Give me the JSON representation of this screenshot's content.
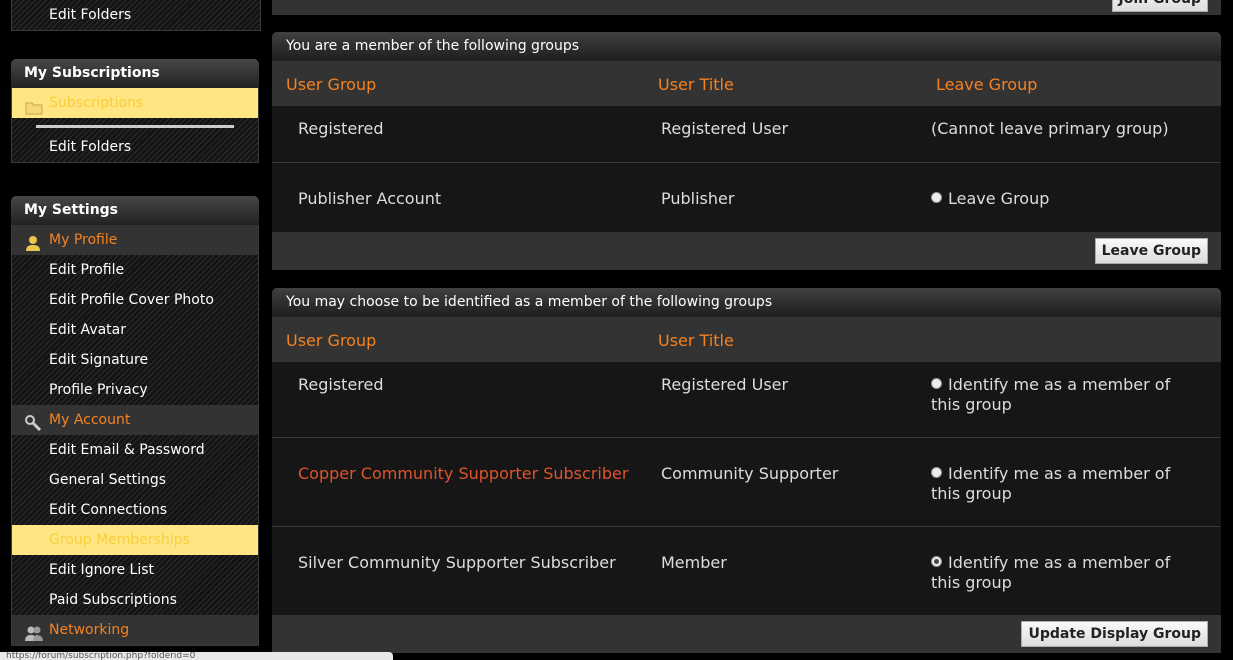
{
  "sidebar": {
    "top_item": "Edit Folders",
    "subscriptions": {
      "title": "My Subscriptions",
      "active": "Subscriptions",
      "edit_folders": "Edit Folders"
    },
    "settings": {
      "title": "My Settings",
      "my_profile": "My Profile",
      "profile_items": [
        "Edit Profile",
        "Edit Profile Cover Photo",
        "Edit Avatar",
        "Edit Signature",
        "Profile Privacy"
      ],
      "my_account": "My Account",
      "account_items": [
        "Edit Email & Password",
        "General Settings",
        "Edit Connections"
      ],
      "active_item": "Group Memberships",
      "account_items_after": [
        "Edit Ignore List",
        "Paid Subscriptions"
      ],
      "networking": "Networking"
    }
  },
  "main": {
    "top_button": "Join Group",
    "member_panel": {
      "title": "You are a member of the following groups",
      "headers": [
        "User Group",
        "User Title",
        "Leave Group"
      ],
      "rows": [
        {
          "group": "Registered",
          "title": "Registered User",
          "action": "(Cannot leave primary group)"
        },
        {
          "group": "Publisher Account",
          "title": "Publisher",
          "action": "Leave Group"
        }
      ],
      "button": "Leave Group"
    },
    "display_panel": {
      "title": "You may choose to be identified as a member of the following groups",
      "headers": [
        "User Group",
        "User Title"
      ],
      "rows": [
        {
          "group": "Registered",
          "title": "Registered User",
          "option": "Identify me as a member of this group",
          "checked": false
        },
        {
          "group": "Copper Community Supporter Subscriber",
          "title": "Community Supporter",
          "option": "Identify me as a member of this group",
          "checked": false,
          "group_color": "#e0542a"
        },
        {
          "group": "Silver Community Supporter Subscriber",
          "title": "Member",
          "option": "Identify me as a member of this group",
          "checked": true
        }
      ],
      "button": "Update Display Group"
    }
  },
  "statusbar": "https://forum/subscription.php?folderid=0",
  "colors": {
    "accent": "#f58220",
    "active_bg": "#ffe583",
    "copper": "#e0542a"
  }
}
